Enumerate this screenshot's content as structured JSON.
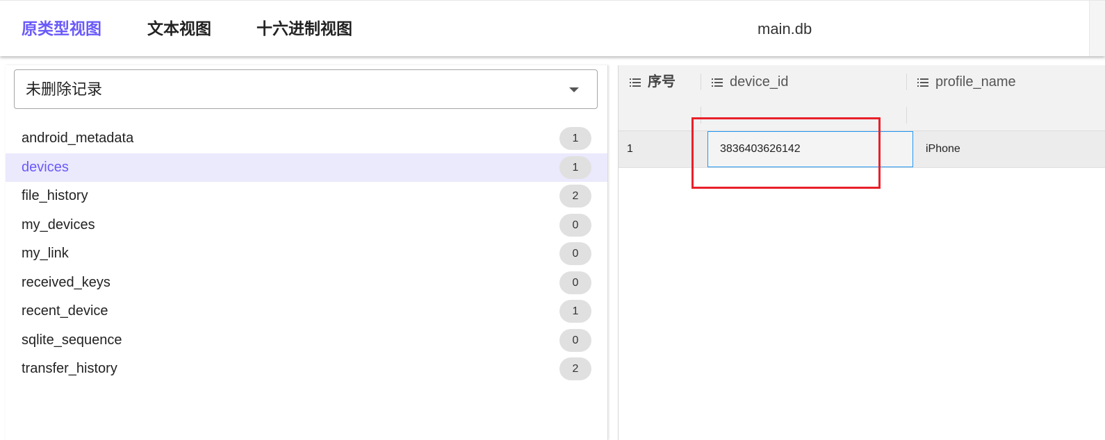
{
  "header": {
    "tabs": [
      {
        "label": "原类型视图",
        "active": true
      },
      {
        "label": "文本视图",
        "active": false
      },
      {
        "label": "十六进制视图",
        "active": false
      }
    ],
    "title": "main.db"
  },
  "sidebar": {
    "filter": {
      "value": "未删除记录"
    },
    "tables": [
      {
        "name": "android_metadata",
        "count": "1"
      },
      {
        "name": "devices",
        "count": "1",
        "selected": true
      },
      {
        "name": "file_history",
        "count": "2"
      },
      {
        "name": "my_devices",
        "count": "0"
      },
      {
        "name": "my_link",
        "count": "0"
      },
      {
        "name": "received_keys",
        "count": "0"
      },
      {
        "name": "recent_device",
        "count": "1"
      },
      {
        "name": "sqlite_sequence",
        "count": "0"
      },
      {
        "name": "transfer_history",
        "count": "2"
      }
    ]
  },
  "grid": {
    "columns": [
      {
        "label": "序号",
        "icon": "list-icon"
      },
      {
        "label": "device_id",
        "icon": "list-icon"
      },
      {
        "label": "profile_name",
        "icon": "list-icon"
      }
    ],
    "rows": [
      {
        "index": "1",
        "device_id": "3836403626142",
        "profile_name": "iPhone"
      }
    ]
  },
  "colors": {
    "accent": "#6a5af9",
    "selected_bg": "#ebe9fc",
    "cell_focus": "#2196f3",
    "annotation": "#e8202a"
  }
}
